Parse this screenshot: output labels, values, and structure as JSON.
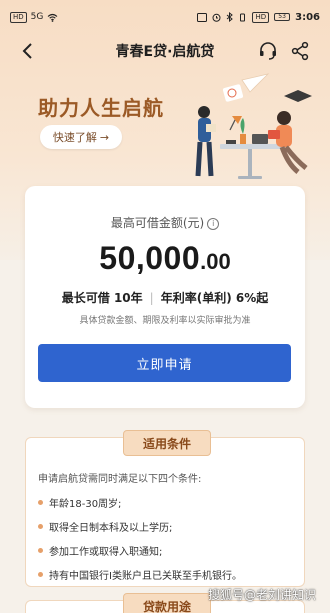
{
  "status_bar": {
    "left_chips": [
      "HD",
      "5G"
    ],
    "right_chips": [
      "HD"
    ],
    "battery": "53",
    "time": "3:06"
  },
  "nav": {
    "title": "青春E贷·启航贷",
    "back_icon": "chevron-left-icon",
    "service_icon": "headset-icon",
    "share_icon": "share-icon"
  },
  "hero": {
    "title": "助力人生启航",
    "button_label": "快速了解",
    "button_arrow": "→"
  },
  "loan_card": {
    "max_label": "最高可借金额(元)",
    "info_icon": "i",
    "amount_int": "50,000",
    "amount_dec": ".00",
    "term_label": "最长可借 10年",
    "rate_label": "年利率(单利) 6%起",
    "note": "具体贷款金额、期限及利率以实际审批为准",
    "apply_label": "立即申请"
  },
  "conditions": {
    "tab_label": "适用条件",
    "intro": "申请启航贷需同时满足以下四个条件:",
    "items": [
      "年龄18-30周岁;",
      "取得全日制本科及以上学历;",
      "参加工作或取得入职通知;",
      "持有中国银行I类账户且已关联至手机银行。"
    ]
  },
  "next_section": {
    "tab_label": "贷款用途"
  },
  "watermark": "搜狐号@老刘讲知识",
  "colors": {
    "accent_blue": "#2f64cf",
    "hero_title": "#9b5a26",
    "tab_bg": "#f7dcc0"
  }
}
